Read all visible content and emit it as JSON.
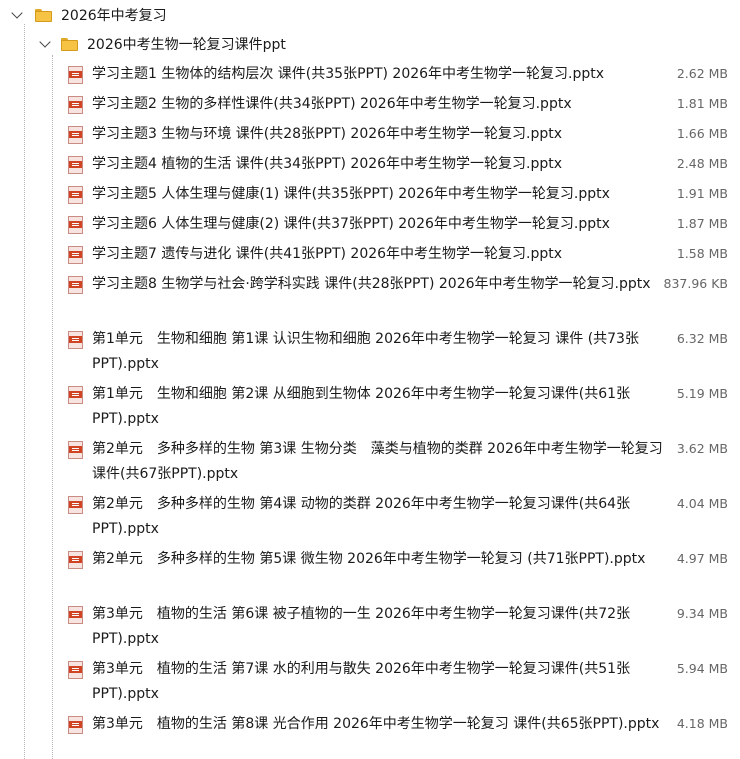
{
  "tree": {
    "root_folder": {
      "name": "2026年中考复习",
      "expanded": true,
      "icon": "folder-icon"
    },
    "sub_folder": {
      "name": "2026中考生物一轮复习课件ppt",
      "expanded": true,
      "icon": "folder-icon"
    },
    "files": [
      {
        "name": "学习主题1 生物体的结构层次 课件(共35张PPT) 2026年中考生物学一轮复习.pptx",
        "size": "2.62 MB",
        "icon": "pptx-file-icon"
      },
      {
        "name": "学习主题2 生物的多样性课件(共34张PPT) 2026年中考生物学一轮复习.pptx",
        "size": "1.81 MB",
        "icon": "pptx-file-icon"
      },
      {
        "name": "学习主题3 生物与环境 课件(共28张PPT) 2026年中考生物学一轮复习.pptx",
        "size": "1.66 MB",
        "icon": "pptx-file-icon"
      },
      {
        "name": "学习主题4 植物的生活 课件(共34张PPT) 2026年中考生物学一轮复习.pptx",
        "size": "2.48 MB",
        "icon": "pptx-file-icon"
      },
      {
        "name": "学习主题5 人体生理与健康(1) 课件(共35张PPT) 2026年中考生物学一轮复习.pptx",
        "size": "1.91 MB",
        "icon": "pptx-file-icon"
      },
      {
        "name": "学习主题6 人体生理与健康(2) 课件(共37张PPT) 2026年中考生物学一轮复习.pptx",
        "size": "1.87 MB",
        "icon": "pptx-file-icon"
      },
      {
        "name": "学习主题7 遗传与进化 课件(共41张PPT) 2026年中考生物学一轮复习.pptx",
        "size": "1.58 MB",
        "icon": "pptx-file-icon"
      },
      {
        "name": "学习主题8 生物学与社会·跨学科实践 课件(共28张PPT) 2026年中考生物学一轮复习.pptx",
        "size": "837.96 KB",
        "icon": "pptx-file-icon"
      },
      {
        "name": "第1单元　生物和细胞 第1课 认识生物和细胞 2026年中考生物学一轮复习 课件 (共73张PPT).pptx",
        "size": "6.32 MB",
        "icon": "pptx-file-icon"
      },
      {
        "name": "第1单元　生物和细胞 第2课 从细胞到生物体 2026年中考生物学一轮复习课件(共61张PPT).pptx",
        "size": "5.19 MB",
        "icon": "pptx-file-icon"
      },
      {
        "name": "第2单元　多种多样的生物 第3课 生物分类　藻类与植物的类群 2026年中考生物学一轮复习课件(共67张PPT).pptx",
        "size": "3.62 MB",
        "icon": "pptx-file-icon"
      },
      {
        "name": "第2单元　多种多样的生物 第4课 动物的类群 2026年中考生物学一轮复习课件(共64张PPT).pptx",
        "size": "4.04 MB",
        "icon": "pptx-file-icon"
      },
      {
        "name": "第2单元　多种多样的生物 第5课 微生物 2026年中考生物学一轮复习 (共71张PPT).pptx",
        "size": "4.97 MB",
        "icon": "pptx-file-icon"
      },
      {
        "name": "第3单元　植物的生活 第6课 被子植物的一生 2026年中考生物学一轮复习课件(共72张PPT).pptx",
        "size": "9.34 MB",
        "icon": "pptx-file-icon"
      },
      {
        "name": "第3单元　植物的生活 第7课 水的利用与散失 2026年中考生物学一轮复习课件(共51张PPT).pptx",
        "size": "5.94 MB",
        "icon": "pptx-file-icon"
      },
      {
        "name": "第3单元　植物的生活 第8课 光合作用 2026年中考生物学一轮复习 课件(共65张PPT).pptx",
        "size": "4.18 MB",
        "icon": "pptx-file-icon"
      }
    ]
  },
  "colors": {
    "folder": "#f6c344",
    "ppt_badge": "#d04423",
    "text": "#1a1a1a",
    "size_text": "#666666",
    "guide_line": "#b4b4b4"
  }
}
